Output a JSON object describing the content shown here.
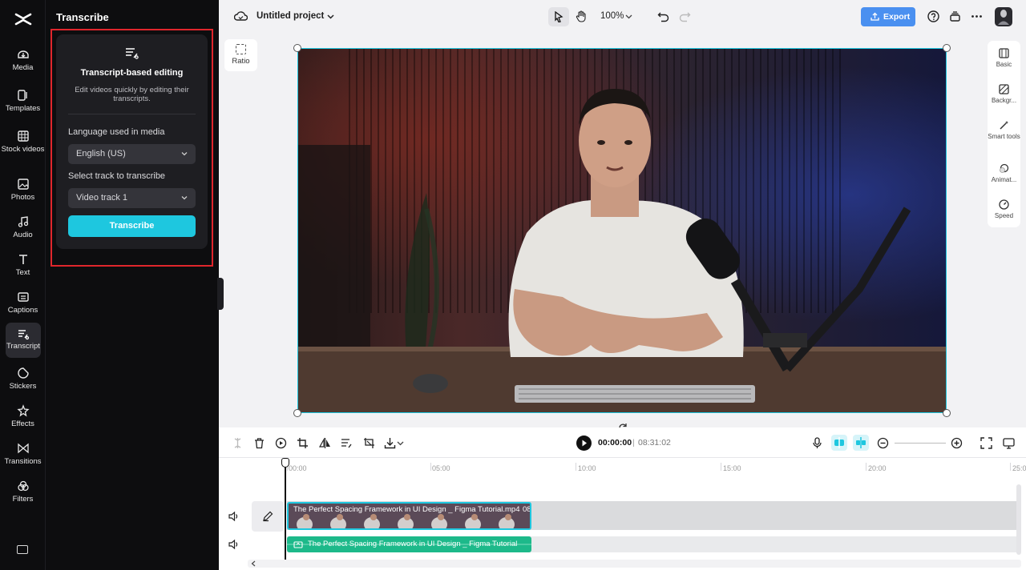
{
  "panel": {
    "title": "Transcribe",
    "card_title": "Transcript-based editing",
    "card_desc": "Edit videos quickly by editing their transcripts.",
    "lang_label": "Language used in media",
    "lang_value": "English (US)",
    "track_label": "Select track to transcribe",
    "track_value": "Video track 1",
    "button": "Transcribe"
  },
  "rail": {
    "items": [
      {
        "label": "Media",
        "icon": "media-icon"
      },
      {
        "label": "Templates",
        "icon": "templates-icon"
      },
      {
        "label": "Stock videos",
        "icon": "stock-videos-icon"
      },
      {
        "label": "Photos",
        "icon": "photos-icon"
      },
      {
        "label": "Audio",
        "icon": "audio-icon"
      },
      {
        "label": "Text",
        "icon": "text-icon"
      },
      {
        "label": "Captions",
        "icon": "captions-icon"
      },
      {
        "label": "Transcript",
        "icon": "transcript-icon"
      },
      {
        "label": "Stickers",
        "icon": "stickers-icon"
      },
      {
        "label": "Effects",
        "icon": "effects-icon"
      },
      {
        "label": "Transitions",
        "icon": "transitions-icon"
      },
      {
        "label": "Filters",
        "icon": "filters-icon"
      }
    ],
    "active": "Transcript"
  },
  "topbar": {
    "project_name": "Untitled project",
    "zoom": "100%",
    "export_label": "Export"
  },
  "canvas": {
    "ratio_label": "Ratio"
  },
  "props": {
    "items": [
      {
        "label": "Basic",
        "icon": "basic-icon"
      },
      {
        "label": "Backgr...",
        "icon": "background-icon"
      },
      {
        "label": "Smart tools",
        "icon": "smart-tools-icon"
      },
      {
        "label": "Animat...",
        "icon": "animation-icon"
      },
      {
        "label": "Speed",
        "icon": "speed-icon"
      }
    ]
  },
  "player": {
    "current_time": "00:00:00",
    "separator": "|",
    "total_time": "08:31:02"
  },
  "timeline": {
    "ruler": [
      "00:00",
      "05:00",
      "10:00",
      "15:00",
      "20:00",
      "25:0"
    ],
    "video_clip_title": "The Perfect Spacing Framework in UI Design _ Figma Tutorial.mp4",
    "video_clip_duration": "08",
    "audio_clip_title": "The Perfect Spacing Framework in UI Design _ Figma Tutorial"
  },
  "colors": {
    "accent": "#1ec7df",
    "export": "#4a90f0",
    "focus_outline": "#e0262c",
    "audio_clip": "#1db98a"
  }
}
